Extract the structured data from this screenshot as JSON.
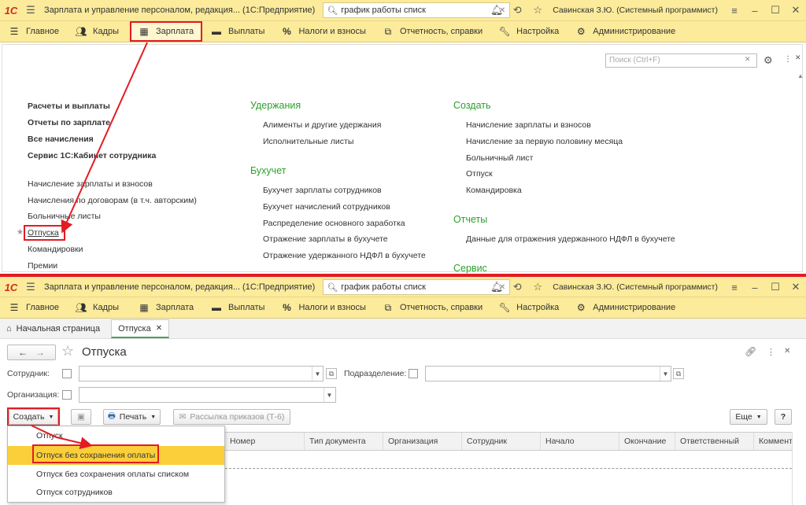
{
  "titlebar": {
    "logo": "1С",
    "app_title": "Зарплата и управление персоналом, редакция...  (1С:Предприятие)",
    "search_value": "график работы списк",
    "user": "Савинская З.Ю. (Системный программист)"
  },
  "menu": {
    "items": [
      {
        "label": "Главное",
        "icon": "hamburger-icon"
      },
      {
        "label": "Кадры",
        "icon": "people-icon"
      },
      {
        "label": "Зарплата",
        "icon": "calculator-icon"
      },
      {
        "label": "Выплаты",
        "icon": "wallet-icon"
      },
      {
        "label": "Налоги и взносы",
        "icon": "percent-icon"
      },
      {
        "label": "Отчетность, справки",
        "icon": "report-icon"
      },
      {
        "label": "Настройка",
        "icon": "wrench-icon"
      },
      {
        "label": "Администрирование",
        "icon": "gear-icon"
      }
    ]
  },
  "top_panel": {
    "search_placeholder": "Поиск (Ctrl+F)",
    "col1_bold": [
      "Расчеты и выплаты",
      "Отчеты по зарплате",
      "Все начисления",
      "Сервис 1С:Кабинет сотрудника"
    ],
    "col1_links": [
      "Начисление зарплаты и взносов",
      "Начисления по договорам (в т.ч. авторским)",
      "Больничные листы",
      "Отпуска",
      "Командировки",
      "Премии"
    ],
    "col2_head1": "Удержания",
    "col2_list1": [
      "Алименты и другие удержания",
      "Исполнительные листы"
    ],
    "col2_head2": "Бухучет",
    "col2_list2": [
      "Бухучет зарплаты сотрудников",
      "Бухучет начислений сотрудников",
      "Распределение основного заработка",
      "Отражение зарплаты в бухучете",
      "Отражение удержанного НДФЛ в бухучете"
    ],
    "col3_head1": "Создать",
    "col3_list1": [
      "Начисление зарплаты и взносов",
      "Начисление за первую половину месяца",
      "Больничный лист",
      "Отпуск",
      "Командировка"
    ],
    "col3_head2": "Отчеты",
    "col3_list2": [
      "Данные для отражения удержанного НДФЛ в бухучете"
    ],
    "col3_head3": "Сервис"
  },
  "tabs": {
    "home": "Начальная страница",
    "active": "Отпуска"
  },
  "form": {
    "title": "Отпуска",
    "employee_label": "Сотрудник:",
    "department_label": "Подразделение:",
    "org_label": "Организация:",
    "create_btn": "Создать",
    "print_btn": "Печать",
    "mailing_btn": "Рассылка приказов (Т-6)",
    "more_btn": "Еще",
    "help_btn": "?"
  },
  "table": {
    "columns": [
      "Номер",
      "Тип документа",
      "Организация",
      "Сотрудник",
      "Начало",
      "Окончание",
      "Ответственный",
      "Коммент"
    ]
  },
  "create_menu": {
    "items": [
      "Отпуск",
      "Отпуск без сохранения оплаты",
      "Отпуск без сохранения оплаты списком",
      "Отпуск сотрудников"
    ]
  },
  "colors": {
    "accent_bar": "#fbeb9b",
    "highlight_red": "#e31b23",
    "section_green": "#2ca02c",
    "selected_item": "#fbcf3a"
  }
}
